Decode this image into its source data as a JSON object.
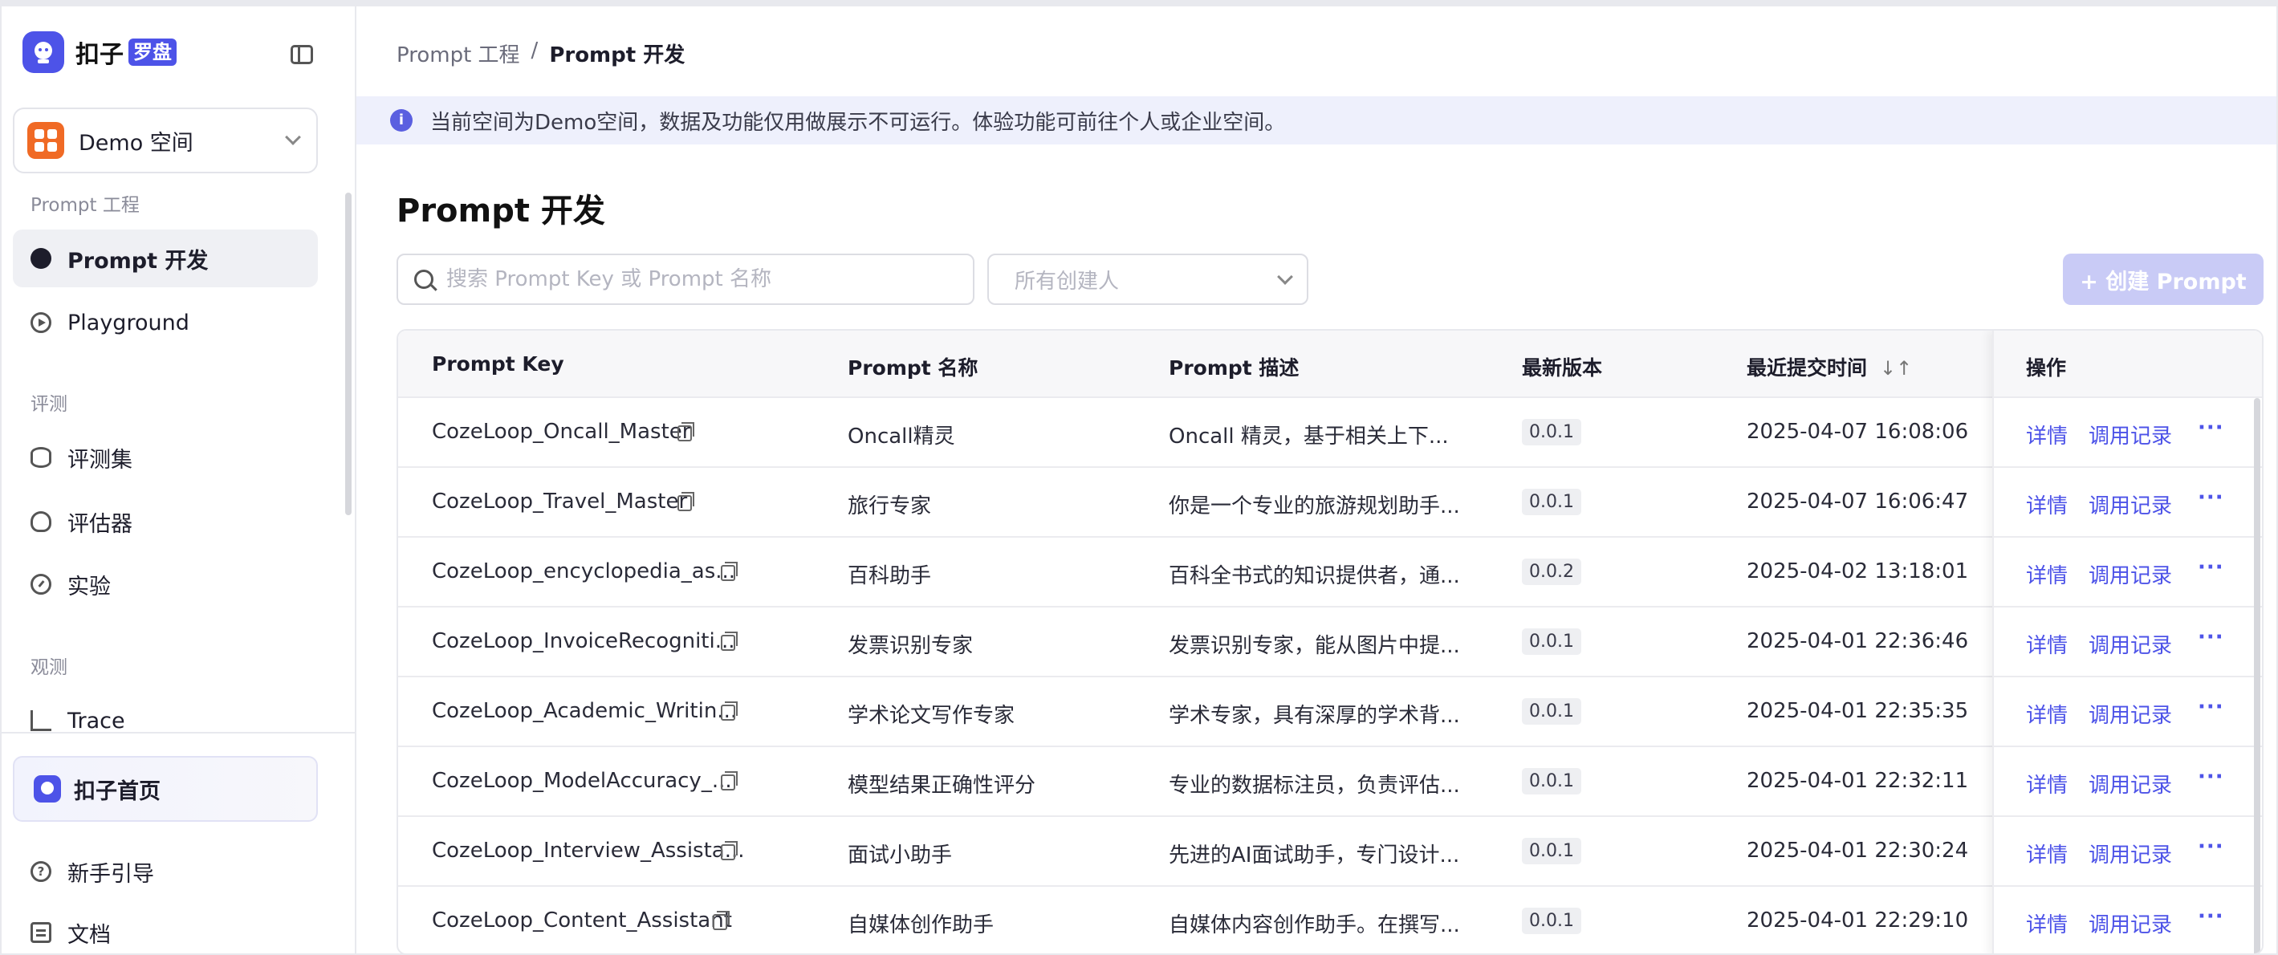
{
  "brand": {
    "name": "扣子",
    "tag": "罗盘"
  },
  "space": {
    "name": "Demo 空间"
  },
  "sidebar": {
    "sections": [
      {
        "label": "Prompt 工程"
      },
      {
        "label": "评测"
      },
      {
        "label": "观测"
      }
    ],
    "items": [
      {
        "label": "Prompt 开发",
        "icon": "chat-icon",
        "active": true
      },
      {
        "label": "Playground",
        "icon": "play-icon"
      },
      {
        "label": "评测集",
        "icon": "database-icon"
      },
      {
        "label": "评估器",
        "icon": "bulb-icon"
      },
      {
        "label": "实验",
        "icon": "gauge-icon"
      },
      {
        "label": "Trace",
        "icon": "trace-icon"
      }
    ],
    "bottom": {
      "home": "扣子首页",
      "guide": "新手引导",
      "docs": "文档"
    }
  },
  "breadcrumb": {
    "parent": "Prompt 工程",
    "separator": "/",
    "current": "Prompt 开发"
  },
  "banner": {
    "text": "当前空间为Demo空间，数据及功能仅用做展示不可运行。体验功能可前往个人或企业空间。"
  },
  "page": {
    "title": "Prompt 开发"
  },
  "filters": {
    "search_placeholder": "搜索 Prompt Key 或 Prompt 名称",
    "creator_placeholder": "所有创建人"
  },
  "create_button": "+ 创建 Prompt",
  "table": {
    "headers": {
      "key": "Prompt Key",
      "name": "Prompt 名称",
      "desc": "Prompt 描述",
      "version": "最新版本",
      "time": "最近提交时间",
      "ops": "操作"
    },
    "op_labels": {
      "detail": "详情",
      "logs": "调用记录",
      "more": "···"
    },
    "rows": [
      {
        "key": "CozeLoop_Oncall_Master",
        "name": "Oncall精灵",
        "desc": "Oncall 精灵，基于相关上下...",
        "version": "0.0.1",
        "time": "2025-04-07 16:08:06"
      },
      {
        "key": "CozeLoop_Travel_Master",
        "name": "旅行专家",
        "desc": "你是一个专业的旅游规划助手...",
        "version": "0.0.1",
        "time": "2025-04-07 16:06:47"
      },
      {
        "key": "CozeLoop_encyclopedia_as...",
        "name": "百科助手",
        "desc": "百科全书式的知识提供者，通...",
        "version": "0.0.2",
        "time": "2025-04-02 13:18:01"
      },
      {
        "key": "CozeLoop_InvoiceRecogniti...",
        "name": "发票识别专家",
        "desc": "发票识别专家，能从图片中提...",
        "version": "0.0.1",
        "time": "2025-04-01 22:36:46"
      },
      {
        "key": "CozeLoop_Academic_Writin...",
        "name": "学术论文写作专家",
        "desc": "学术专家，具有深厚的学术背...",
        "version": "0.0.1",
        "time": "2025-04-01 22:35:35"
      },
      {
        "key": "CozeLoop_ModelAccuracy_...",
        "name": "模型结果正确性评分",
        "desc": "专业的数据标注员，负责评估...",
        "version": "0.0.1",
        "time": "2025-04-01 22:32:11"
      },
      {
        "key": "CozeLoop_Interview_Assista...",
        "name": "面试小助手",
        "desc": "先进的AI面试助手，专门设计...",
        "version": "0.0.1",
        "time": "2025-04-01 22:30:24"
      },
      {
        "key": "CozeLoop_Content_Assistant",
        "name": "自媒体创作助手",
        "desc": "自媒体内容创作助手。在撰写...",
        "version": "0.0.1",
        "time": "2025-04-01 22:29:10"
      }
    ]
  },
  "colors": {
    "accent": "#4d53e8",
    "banner_bg": "#eef0fc",
    "orange": "#f06a25"
  }
}
